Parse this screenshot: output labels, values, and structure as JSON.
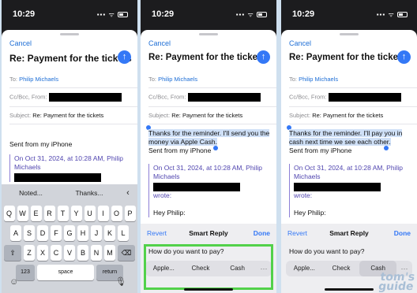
{
  "status": {
    "time": "10:29",
    "signal": "▪▪▪ ᯤ"
  },
  "compose": {
    "cancel_label": "Cancel",
    "subject_title": "Re: Payment for the tickets",
    "to_label": "To:",
    "to_value": "Philip Michaels",
    "ccbcc_label": "Cc/Bcc, From:",
    "subject_label": "Subject:",
    "subject_value": "Re: Payment for the tickets"
  },
  "phone1": {
    "body": "Sent from my iPhone",
    "quote_header": "On Oct 31, 2024, at 10:28 AM, Philip Michaels"
  },
  "keyboard": {
    "suggestions": [
      "Noted...",
      "Thanks...",
      "‹"
    ],
    "row1": [
      "Q",
      "W",
      "E",
      "R",
      "T",
      "Y",
      "U",
      "I",
      "O",
      "P"
    ],
    "row2": [
      "A",
      "S",
      "D",
      "F",
      "G",
      "H",
      "J",
      "K",
      "L"
    ],
    "row3": [
      "Z",
      "X",
      "C",
      "V",
      "B",
      "N",
      "M"
    ],
    "shift": "⇧",
    "backspace": "⌫",
    "numbers": "123",
    "space": "space",
    "return": "return",
    "emoji": "☺",
    "mic": "🎙"
  },
  "phone2": {
    "reply": "Thanks for the reminder. I'll send you the money via Apple Cash.",
    "sig": "Sent from my iPhone",
    "quote_header": "On Oct 31, 2024, at 10:28 AM, Philip Michaels",
    "wrote": "wrote:",
    "hey": "Hey Philip:"
  },
  "phone3": {
    "reply": "Thanks for the reminder. I'll pay you in cash next time we see each other.",
    "sig": "Sent from my iPhone",
    "quote_header": "On Oct 31, 2024, at 10:28 AM, Philip Michaels",
    "wrote": "wrote:",
    "hey": "Hey Philip:"
  },
  "smart_reply": {
    "revert": "Revert",
    "title": "Smart Reply",
    "done": "Done",
    "question": "How do you want to pay?",
    "options": [
      "Apple...",
      "Check",
      "Cash"
    ],
    "more": "⋯"
  },
  "watermark": {
    "line1": "tom's",
    "line2": "guide"
  }
}
